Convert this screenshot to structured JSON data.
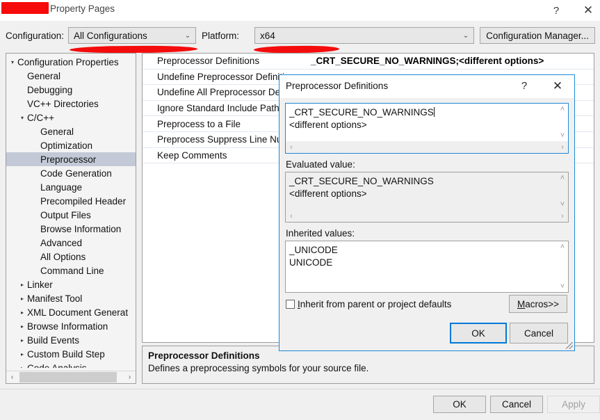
{
  "window": {
    "title": "Property Pages",
    "redacted_prefix": true,
    "help_icon": "?",
    "close_icon": "✕"
  },
  "config_bar": {
    "configuration_label": "Configuration:",
    "configuration_value": "All Configurations",
    "platform_label": "Platform:",
    "platform_value": "x64",
    "configuration_manager_label": "Configuration Manager...",
    "chevron_icon": "⌄"
  },
  "tree": {
    "items": [
      {
        "label": "Configuration Properties",
        "indent": 0,
        "arrow": "▾",
        "selected": false
      },
      {
        "label": "General",
        "indent": 1,
        "arrow": "",
        "selected": false
      },
      {
        "label": "Debugging",
        "indent": 1,
        "arrow": "",
        "selected": false
      },
      {
        "label": "VC++ Directories",
        "indent": 1,
        "arrow": "",
        "selected": false
      },
      {
        "label": "C/C++",
        "indent": 1,
        "arrow": "▾",
        "selected": false
      },
      {
        "label": "General",
        "indent": 2,
        "arrow": "",
        "selected": false
      },
      {
        "label": "Optimization",
        "indent": 2,
        "arrow": "",
        "selected": false
      },
      {
        "label": "Preprocessor",
        "indent": 2,
        "arrow": "",
        "selected": true
      },
      {
        "label": "Code Generation",
        "indent": 2,
        "arrow": "",
        "selected": false
      },
      {
        "label": "Language",
        "indent": 2,
        "arrow": "",
        "selected": false
      },
      {
        "label": "Precompiled Header",
        "indent": 2,
        "arrow": "",
        "selected": false
      },
      {
        "label": "Output Files",
        "indent": 2,
        "arrow": "",
        "selected": false
      },
      {
        "label": "Browse Information",
        "indent": 2,
        "arrow": "",
        "selected": false
      },
      {
        "label": "Advanced",
        "indent": 2,
        "arrow": "",
        "selected": false
      },
      {
        "label": "All Options",
        "indent": 2,
        "arrow": "",
        "selected": false
      },
      {
        "label": "Command Line",
        "indent": 2,
        "arrow": "",
        "selected": false
      },
      {
        "label": "Linker",
        "indent": 1,
        "arrow": "▸",
        "selected": false
      },
      {
        "label": "Manifest Tool",
        "indent": 1,
        "arrow": "▸",
        "selected": false
      },
      {
        "label": "XML Document Generat",
        "indent": 1,
        "arrow": "▸",
        "selected": false
      },
      {
        "label": "Browse Information",
        "indent": 1,
        "arrow": "▸",
        "selected": false
      },
      {
        "label": "Build Events",
        "indent": 1,
        "arrow": "▸",
        "selected": false
      },
      {
        "label": "Custom Build Step",
        "indent": 1,
        "arrow": "▸",
        "selected": false
      },
      {
        "label": "Code Analysis",
        "indent": 1,
        "arrow": "▸",
        "selected": false
      }
    ],
    "scroll_left_icon": "‹",
    "scroll_right_icon": "›"
  },
  "property_grid": {
    "rows": [
      {
        "name": "Preprocessor Definitions",
        "value": "_CRT_SECURE_NO_WARNINGS;<different options>"
      },
      {
        "name": "Undefine Preprocessor Definitions",
        "value": ""
      },
      {
        "name": "Undefine All Preprocessor Definitions",
        "value": ""
      },
      {
        "name": "Ignore Standard Include Paths",
        "value": ""
      },
      {
        "name": "Preprocess to a File",
        "value": ""
      },
      {
        "name": "Preprocess Suppress Line Numbers",
        "value": ""
      },
      {
        "name": "Keep Comments",
        "value": ""
      }
    ]
  },
  "description": {
    "title": "Preprocessor Definitions",
    "text": "Defines a preprocessing symbols for your source file."
  },
  "footer": {
    "ok_label": "OK",
    "cancel_label": "Cancel",
    "apply_label": "Apply",
    "apply_disabled": true
  },
  "modal": {
    "title": "Preprocessor Definitions",
    "help_icon": "?",
    "close_icon": "✕",
    "main_value": "_CRT_SECURE_NO_WARNINGS\n<different options>",
    "main_line_1": "_CRT_SECURE_NO_WARNINGS",
    "main_line_2": "<different options>",
    "evaluated_label": "Evaluated value:",
    "evaluated_line_1": "_CRT_SECURE_NO_WARNINGS",
    "evaluated_line_2": "<different options>",
    "inherited_label": "Inherited values:",
    "inherited_line_1": "_UNICODE",
    "inherited_line_2": "UNICODE",
    "inherit_checkbox_label": "Inherit from parent or project defaults",
    "inherit_checkbox_mnemonic": "I",
    "inherit_checkbox_rest": "nherit from parent or project defaults",
    "inherit_checked": false,
    "macros_mnemonic": "M",
    "macros_rest": "acros>>",
    "ok_label": "OK",
    "cancel_label": "Cancel",
    "scroll_up_icon": "˄",
    "scroll_down_icon": "˅",
    "scroll_left_icon": "‹",
    "scroll_right_icon": "›"
  },
  "colors": {
    "accent": "#0078d7",
    "annotation_red": "#f40c0c",
    "selection": "#c3c9d6",
    "window_bg": "#f0f0f0"
  }
}
